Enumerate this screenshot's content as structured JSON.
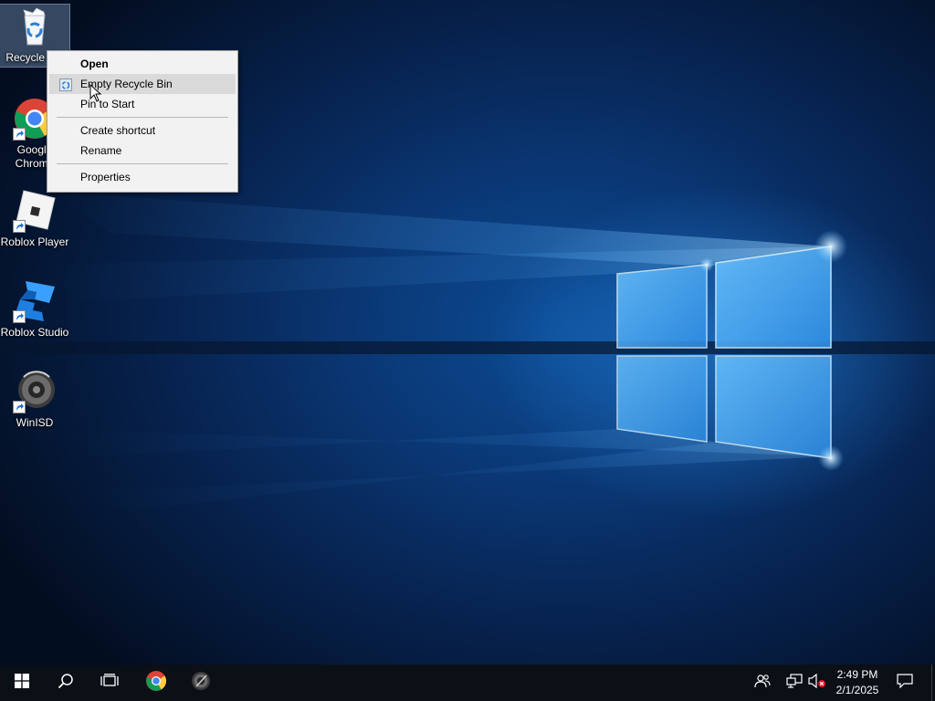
{
  "desktop": {
    "icons": [
      {
        "label": "Recycle Bin",
        "icon": "recycle-bin-icon"
      },
      {
        "label": "Google Chrome",
        "icon": "chrome-icon"
      },
      {
        "label": "Roblox Player",
        "icon": "roblox-player-icon"
      },
      {
        "label": "Roblox Studio",
        "icon": "roblox-studio-icon"
      },
      {
        "label": "WinISD",
        "icon": "winisd-icon"
      }
    ]
  },
  "context_menu": {
    "items": [
      {
        "label": "Open",
        "default": true
      },
      {
        "label": "Empty Recycle Bin",
        "icon": "recycle-bin-small-icon",
        "highlighted": true
      },
      {
        "label": "Pin to Start"
      },
      {
        "label": "Create shortcut"
      },
      {
        "label": "Rename"
      },
      {
        "label": "Properties"
      }
    ]
  },
  "taskbar": {
    "buttons": [
      {
        "name": "start",
        "icon": "windows-logo-icon"
      },
      {
        "name": "search",
        "icon": "search-icon"
      },
      {
        "name": "task-view",
        "icon": "task-view-icon"
      },
      {
        "name": "chrome",
        "icon": "chrome-icon"
      },
      {
        "name": "winisd",
        "icon": "winisd-icon"
      }
    ],
    "tray": [
      {
        "name": "people",
        "icon": "people-icon"
      },
      {
        "name": "network",
        "icon": "network-icon"
      },
      {
        "name": "volume",
        "icon": "volume-muted-icon"
      }
    ],
    "clock": {
      "time": "2:49 PM",
      "date": "2/1/2025"
    },
    "notification_icon": "action-center-icon"
  },
  "colors": {
    "taskbar": "#0b0f16",
    "menu_bg": "#f2f2f2",
    "menu_hover": "#dadada",
    "wallpaper_glow": "#3fa7ff"
  }
}
